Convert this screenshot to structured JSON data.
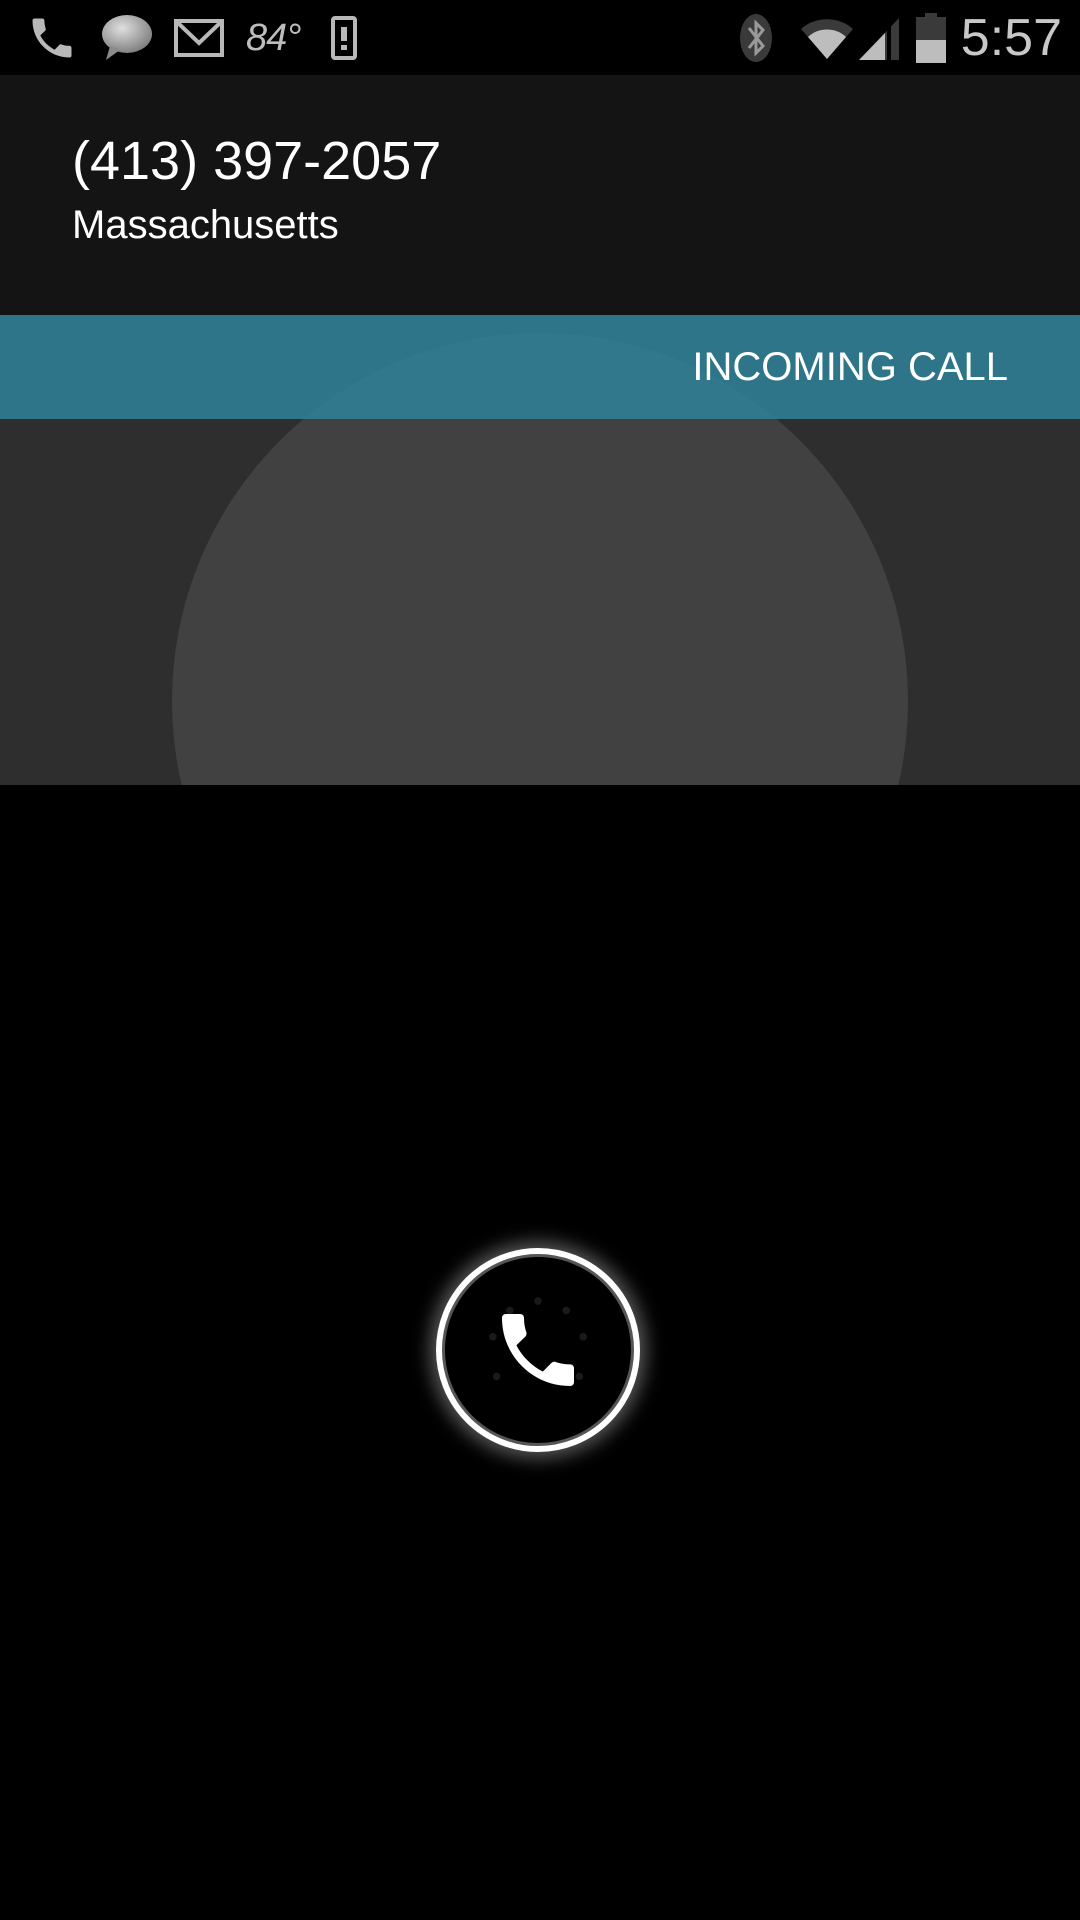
{
  "status_bar": {
    "notifications": [
      "phone-icon",
      "chat-bubble-icon",
      "gmail-icon",
      "weather-temp",
      "device-icon"
    ],
    "temperature": "84°",
    "right_icons": [
      "bluetooth-icon",
      "wifi-icon",
      "cell-signal-icon",
      "battery-icon"
    ],
    "time": "5:57"
  },
  "caller": {
    "number": "(413) 397-2057",
    "location": "Massachusetts"
  },
  "call": {
    "state": "INCOMING CALL",
    "accent_color": "#308096"
  },
  "answer_handle": {
    "icon": "phone-handset-icon"
  }
}
